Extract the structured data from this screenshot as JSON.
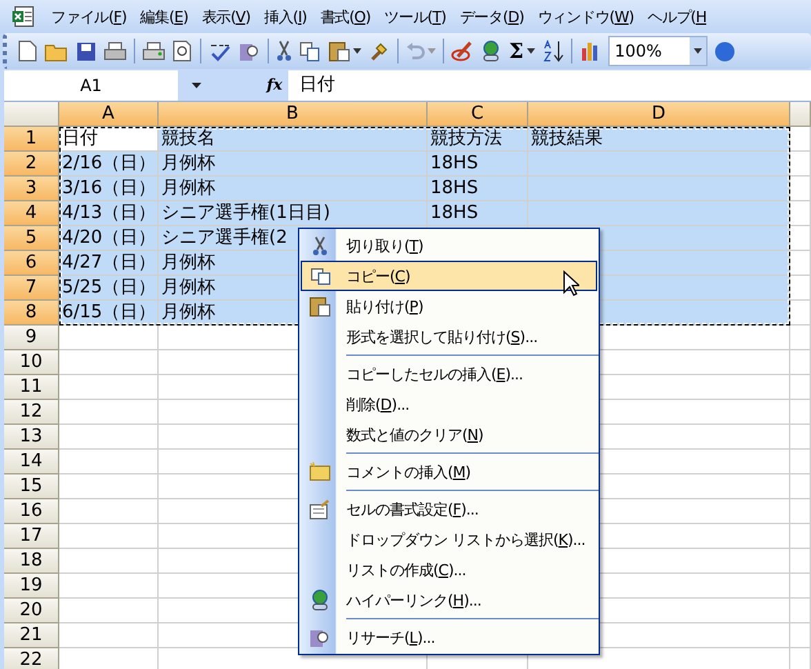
{
  "menu_bar": [
    {
      "text": "ファイル(",
      "key": "F",
      "after": ")"
    },
    {
      "text": "編集(",
      "key": "E",
      "after": ")"
    },
    {
      "text": "表示(",
      "key": "V",
      "after": ")"
    },
    {
      "text": "挿入(",
      "key": "I",
      "after": ")"
    },
    {
      "text": "書式(",
      "key": "O",
      "after": ")"
    },
    {
      "text": "ツール(",
      "key": "T",
      "after": ")"
    },
    {
      "text": "データ(",
      "key": "D",
      "after": ")"
    },
    {
      "text": "ウィンドウ(",
      "key": "W",
      "after": ")"
    },
    {
      "text": "ヘルプ(",
      "key": "H"
    }
  ],
  "toolbar": {
    "autosum": "Σ",
    "zoom": "100%"
  },
  "formula_bar": {
    "name_box": "A1",
    "fx": "fx",
    "value": "日付"
  },
  "grid": {
    "columns": [
      {
        "label": "A",
        "selected": true
      },
      {
        "label": "B",
        "selected": true
      },
      {
        "label": "C",
        "selected": true
      },
      {
        "label": "D",
        "selected": true
      }
    ],
    "rows": [
      {
        "header": "1",
        "selected": true,
        "cells": [
          {
            "text": "日付",
            "active": true
          },
          {
            "text": "競技名",
            "active": false
          },
          {
            "text": "競技方法",
            "active": false
          },
          {
            "text": "競技結果",
            "active": false
          }
        ]
      },
      {
        "header": "2",
        "selected": true,
        "cells": [
          {
            "text": "2/16（日）",
            "active": false
          },
          {
            "text": "月例杯",
            "active": false
          },
          {
            "text": "18HS",
            "active": false
          }
        ]
      },
      {
        "header": "3",
        "selected": true,
        "cells": [
          {
            "text": "3/16（日）",
            "active": false
          },
          {
            "text": "月例杯",
            "active": false
          },
          {
            "text": "18HS",
            "active": false
          }
        ]
      },
      {
        "header": "4",
        "selected": true,
        "cells": [
          {
            "text": "4/13（日）",
            "active": false
          },
          {
            "text": "シニア選手権(1日目)",
            "active": false
          },
          {
            "text": "18HS",
            "active": false
          }
        ]
      },
      {
        "header": "5",
        "selected": true,
        "cells": [
          {
            "text": "4/20（日）",
            "active": false
          },
          {
            "text": "シニア選手権(2",
            "active": false
          }
        ]
      },
      {
        "header": "6",
        "selected": true,
        "cells": [
          {
            "text": "4/27（日）",
            "active": false
          },
          {
            "text": "月例杯",
            "active": false
          }
        ]
      },
      {
        "header": "7",
        "selected": true,
        "cells": [
          {
            "text": "5/25（日）",
            "active": false
          },
          {
            "text": "月例杯",
            "active": false
          }
        ]
      },
      {
        "header": "8",
        "selected": true,
        "cells": [
          {
            "text": "6/15（日）",
            "active": false
          },
          {
            "text": "月例杯",
            "active": false
          }
        ]
      },
      {
        "header": "9",
        "selected": false
      },
      {
        "header": "10",
        "selected": false
      },
      {
        "header": "11",
        "selected": false
      },
      {
        "header": "12",
        "selected": false
      },
      {
        "header": "13",
        "selected": false
      },
      {
        "header": "14",
        "selected": false
      },
      {
        "header": "15",
        "selected": false
      },
      {
        "header": "16",
        "selected": false
      },
      {
        "header": "17",
        "selected": false
      },
      {
        "header": "18",
        "selected": false
      },
      {
        "header": "19",
        "selected": false
      },
      {
        "header": "20",
        "selected": false
      },
      {
        "header": "21",
        "selected": false
      },
      {
        "header": "22",
        "selected": false
      }
    ]
  },
  "context_menu": [
    {
      "text": "切り取り(",
      "key": "T",
      "after": ")",
      "selected": false,
      "separator_before": false
    },
    {
      "text": "コピー(",
      "key": "C",
      "after": ")",
      "selected": true,
      "separator_before": false
    },
    {
      "text": "貼り付け(",
      "key": "P",
      "after": ")",
      "selected": false,
      "separator_before": false
    },
    {
      "text": "形式を選択して貼り付け(",
      "key": "S",
      "after": ")...",
      "selected": false,
      "separator_before": false
    },
    {
      "text": "コピーしたセルの挿入(",
      "key": "E",
      "after": ")...",
      "selected": false,
      "separator_before": true
    },
    {
      "text": "削除(",
      "key": "D",
      "after": ")...",
      "selected": false,
      "separator_before": false
    },
    {
      "text": "数式と値のクリア(",
      "key": "N",
      "after": ")",
      "selected": false,
      "separator_before": false
    },
    {
      "text": "コメントの挿入(",
      "key": "M",
      "after": ")",
      "selected": false,
      "separator_before": true
    },
    {
      "text": "セルの書式設定(",
      "key": "F",
      "after": ")...",
      "selected": false,
      "separator_before": true
    },
    {
      "text": "ドロップダウン リストから選択(",
      "key": "K",
      "after": ")...",
      "selected": false,
      "separator_before": false
    },
    {
      "text": "リストの作成(",
      "key": "C",
      "after": ")...",
      "selected": false,
      "separator_before": false
    },
    {
      "text": "ハイパーリンク(",
      "key": "H",
      "after": ")...",
      "selected": false,
      "separator_before": false
    },
    {
      "text": "リサーチ(",
      "key": "L",
      "after": ")...",
      "selected": false,
      "separator_before": true
    }
  ]
}
